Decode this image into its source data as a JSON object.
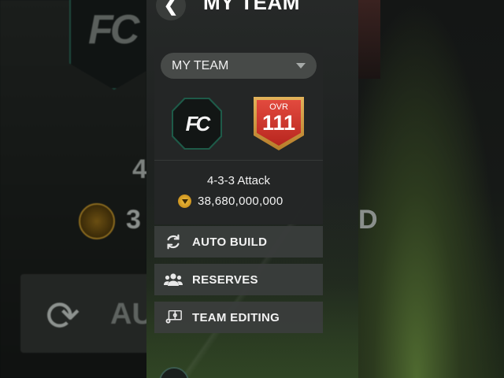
{
  "header": {
    "title": "MY TEAM",
    "back_glyph": "❮"
  },
  "team_select": {
    "selected": "MY TEAM"
  },
  "team_card": {
    "logo_text": "FC",
    "ovr_label": "OVR",
    "ovr_value": "111",
    "formation": "4-3-3 Attack",
    "team_value": "38,680,000,000"
  },
  "menu": [
    {
      "label": "AUTO BUILD",
      "icon": "sync-icon"
    },
    {
      "label": "RESERVES",
      "icon": "users-icon"
    },
    {
      "label": "TEAM EDITING",
      "icon": "team-edit-icon"
    }
  ],
  "background": {
    "ghost_logo": "FC",
    "ghost_4": "4",
    "ghost_3": "3",
    "ghost_au": "AU",
    "ghost_d": "D",
    "sync_glyph": "⟳"
  },
  "colors": {
    "ovr_red": "#d8352b",
    "ovr_gold": "#d6a24a",
    "coin_gold": "#e2aa2a",
    "crest_green": "#1e5a48"
  }
}
